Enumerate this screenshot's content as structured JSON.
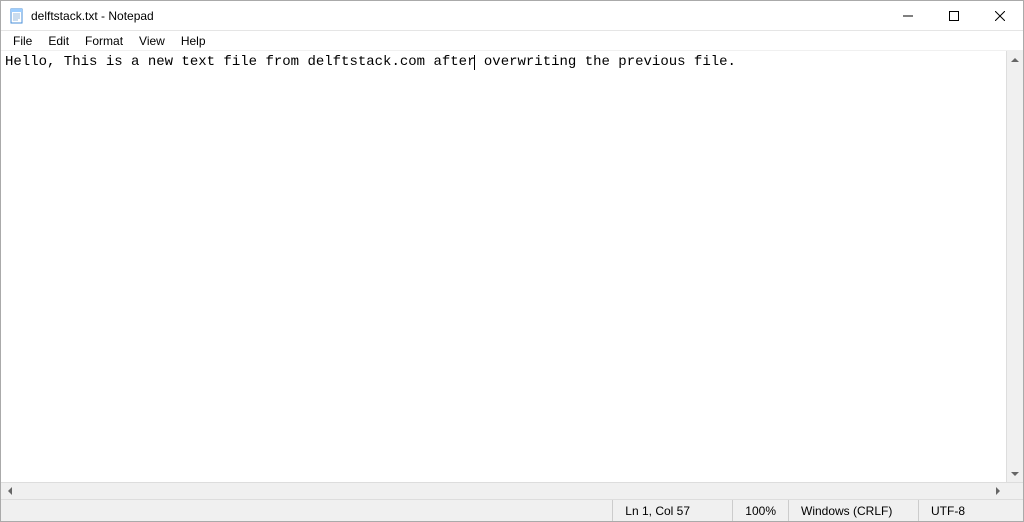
{
  "title": "delftstack.txt - Notepad",
  "menu": {
    "file": "File",
    "edit": "Edit",
    "format": "Format",
    "view": "View",
    "help": "Help"
  },
  "editor": {
    "content_before_cursor": "Hello, This is a new text file from delftstack.com after",
    "content_after_cursor": " overwriting the previous file."
  },
  "statusbar": {
    "position": "Ln 1, Col 57",
    "zoom": "100%",
    "line_ending": "Windows (CRLF)",
    "encoding": "UTF-8"
  }
}
